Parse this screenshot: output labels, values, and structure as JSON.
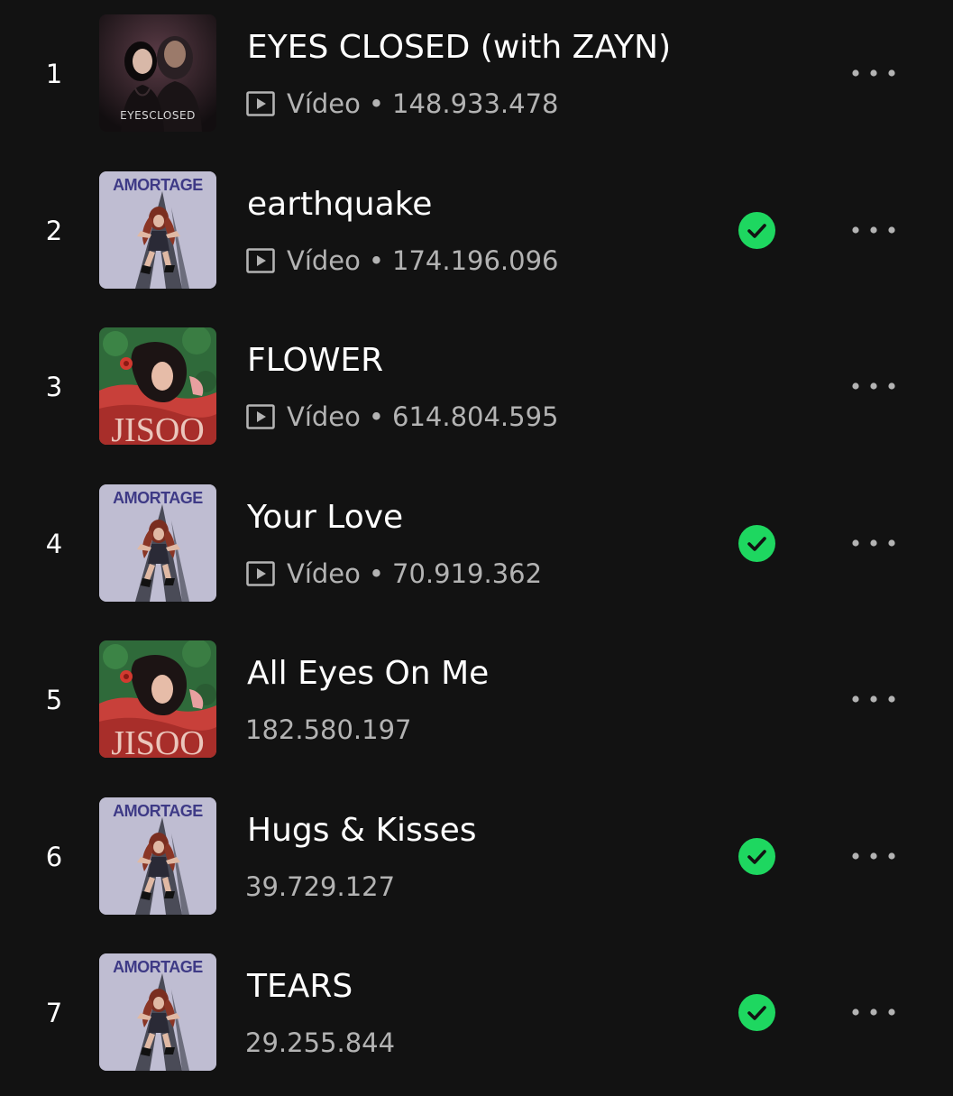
{
  "meta_type_label": "Vídeo",
  "meta_separator": "•",
  "colors": {
    "background": "#121212",
    "text_primary": "#ffffff",
    "text_secondary": "#b3b3b3",
    "saved_green": "#1ed760"
  },
  "icons": {
    "video": "video-icon",
    "saved": "check-circle-icon",
    "more": "more-options-icon"
  },
  "covers": {
    "eyes_closed": {
      "text": "EYESCLOSED"
    },
    "amortage": {
      "text": "AMORTAGE"
    },
    "jisoo": {
      "text": "JISOO"
    }
  },
  "tracks": [
    {
      "rank": "1",
      "title": "EYES CLOSED (with ZAYN)",
      "cover": "eyes_closed",
      "has_video": true,
      "plays": "148.933.478",
      "saved": false
    },
    {
      "rank": "2",
      "title": "earthquake",
      "cover": "amortage",
      "has_video": true,
      "plays": "174.196.096",
      "saved": true
    },
    {
      "rank": "3",
      "title": "FLOWER",
      "cover": "jisoo",
      "has_video": true,
      "plays": "614.804.595",
      "saved": false
    },
    {
      "rank": "4",
      "title": "Your Love",
      "cover": "amortage",
      "has_video": true,
      "plays": "70.919.362",
      "saved": true
    },
    {
      "rank": "5",
      "title": "All Eyes On Me",
      "cover": "jisoo",
      "has_video": false,
      "plays": "182.580.197",
      "saved": false
    },
    {
      "rank": "6",
      "title": "Hugs & Kisses",
      "cover": "amortage",
      "has_video": false,
      "plays": "39.729.127",
      "saved": true
    },
    {
      "rank": "7",
      "title": "TEARS",
      "cover": "amortage",
      "has_video": false,
      "plays": "29.255.844",
      "saved": true
    }
  ]
}
